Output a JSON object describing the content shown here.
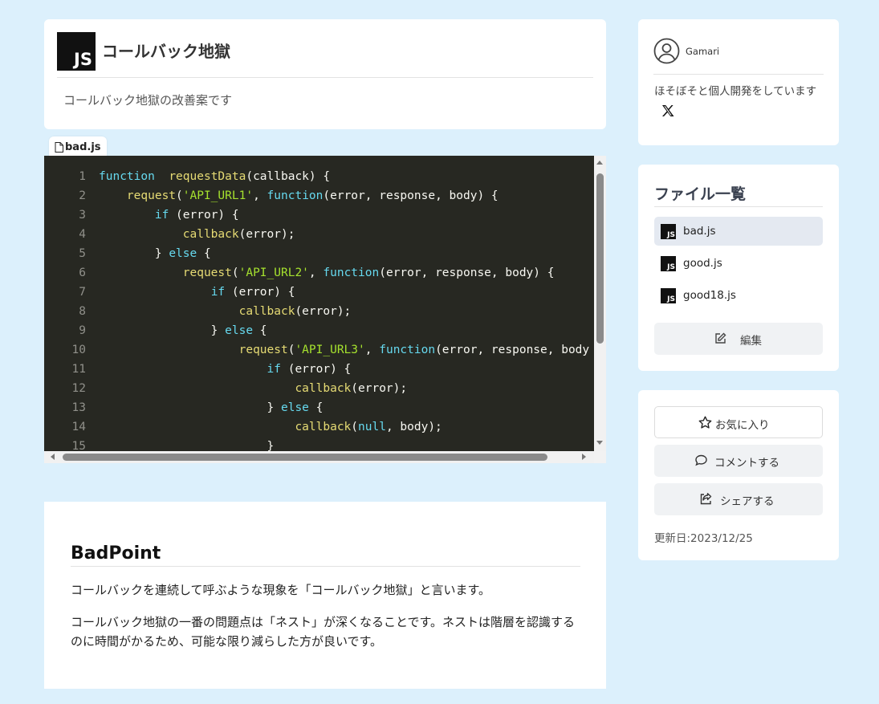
{
  "header": {
    "logo_text": "JS",
    "title": "コールバック地獄",
    "description": "コールバック地獄の改善案です"
  },
  "file_tab": {
    "icon": "file-icon",
    "label": "bad.js"
  },
  "code": {
    "lines": [
      {
        "n": "1",
        "tokens": [
          [
            "k",
            "function"
          ],
          [
            "",
            "  "
          ],
          [
            "f",
            "requestData"
          ],
          [
            "",
            "(callback) {"
          ]
        ]
      },
      {
        "n": "2",
        "tokens": [
          [
            "",
            "    "
          ],
          [
            "f",
            "request"
          ],
          [
            "",
            "("
          ],
          [
            "s",
            "'API_URL1'"
          ],
          [
            "",
            ", "
          ],
          [
            "k",
            "function"
          ],
          [
            "",
            "(error, response, body) {"
          ]
        ]
      },
      {
        "n": "3",
        "tokens": [
          [
            "",
            "        "
          ],
          [
            "k",
            "if"
          ],
          [
            "",
            " (error) {"
          ]
        ]
      },
      {
        "n": "4",
        "tokens": [
          [
            "",
            "            "
          ],
          [
            "f",
            "callback"
          ],
          [
            "",
            "(error);"
          ]
        ]
      },
      {
        "n": "5",
        "tokens": [
          [
            "",
            "        } "
          ],
          [
            "k",
            "else"
          ],
          [
            "",
            " {"
          ]
        ]
      },
      {
        "n": "6",
        "tokens": [
          [
            "",
            "            "
          ],
          [
            "f",
            "request"
          ],
          [
            "",
            "("
          ],
          [
            "s",
            "'API_URL2'"
          ],
          [
            "",
            ", "
          ],
          [
            "k",
            "function"
          ],
          [
            "",
            "(error, response, body) {"
          ]
        ]
      },
      {
        "n": "7",
        "tokens": [
          [
            "",
            "                "
          ],
          [
            "k",
            "if"
          ],
          [
            "",
            " (error) {"
          ]
        ]
      },
      {
        "n": "8",
        "tokens": [
          [
            "",
            "                    "
          ],
          [
            "f",
            "callback"
          ],
          [
            "",
            "(error);"
          ]
        ]
      },
      {
        "n": "9",
        "tokens": [
          [
            "",
            "                } "
          ],
          [
            "k",
            "else"
          ],
          [
            "",
            " {"
          ]
        ]
      },
      {
        "n": "10",
        "tokens": [
          [
            "",
            "                    "
          ],
          [
            "f",
            "request"
          ],
          [
            "",
            "("
          ],
          [
            "s",
            "'API_URL3'"
          ],
          [
            "",
            ", "
          ],
          [
            "k",
            "function"
          ],
          [
            "",
            "(error, response, body"
          ]
        ]
      },
      {
        "n": "11",
        "tokens": [
          [
            "",
            "                        "
          ],
          [
            "k",
            "if"
          ],
          [
            "",
            " (error) {"
          ]
        ]
      },
      {
        "n": "12",
        "tokens": [
          [
            "",
            "                            "
          ],
          [
            "f",
            "callback"
          ],
          [
            "",
            "(error);"
          ]
        ]
      },
      {
        "n": "13",
        "tokens": [
          [
            "",
            "                        } "
          ],
          [
            "k",
            "else"
          ],
          [
            "",
            " {"
          ]
        ]
      },
      {
        "n": "14",
        "tokens": [
          [
            "",
            "                            "
          ],
          [
            "f",
            "callback"
          ],
          [
            "",
            "("
          ],
          [
            "k",
            "null"
          ],
          [
            "",
            ", body);"
          ]
        ]
      },
      {
        "n": "15",
        "tokens": [
          [
            "",
            "                        }"
          ]
        ]
      }
    ]
  },
  "badpoint": {
    "title": "BadPoint",
    "p1": "コールバックを連続して呼ぶような現象を「コールバック地獄」と言います。",
    "p2": "コールバック地獄の一番の問題点は「ネスト」が深くなることです。ネストは階層を認識するのに時間がかるため、可能な限り減らした方が良いです。"
  },
  "profile": {
    "username": "Gamari",
    "bio": "ほそぼそと個人開発をしています",
    "social_icon": "x-logo-icon"
  },
  "files": {
    "title": "ファイル一覧",
    "items": [
      {
        "name": "bad.js",
        "active": true
      },
      {
        "name": "good.js",
        "active": false
      },
      {
        "name": "good18.js",
        "active": false
      }
    ],
    "edit_label": "編集"
  },
  "actions": {
    "favorite_label": "お気に入り",
    "comment_label": "コメントする",
    "share_label": "シェアする",
    "updated": "更新日:2023/12/25"
  }
}
